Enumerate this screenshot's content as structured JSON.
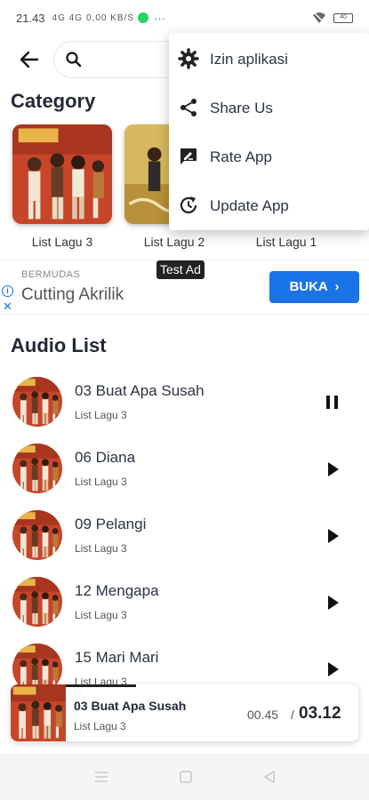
{
  "status_bar": {
    "time": "21.43",
    "signal": "4G 4G",
    "speed": "0,00 KB/S",
    "more": "···",
    "battery": "40"
  },
  "search": {
    "placeholder": ""
  },
  "category": {
    "heading": "Category",
    "items": [
      {
        "name": "List Lagu 3"
      },
      {
        "name": "List Lagu 2"
      },
      {
        "name": "List Lagu 1"
      }
    ]
  },
  "ad": {
    "tag": "Test Ad",
    "brand": "BERMUDAS",
    "headline": "Cutting Akrilik",
    "info": "i",
    "close": "✕",
    "cta": "BUKA"
  },
  "audio_list": {
    "heading": "Audio List",
    "items": [
      {
        "title": "03 Buat Apa Susah",
        "subtitle": "List Lagu 3",
        "state": "pause"
      },
      {
        "title": "06 Diana",
        "subtitle": "List Lagu 3",
        "state": "play"
      },
      {
        "title": "09 Pelangi",
        "subtitle": "List Lagu 3",
        "state": "play"
      },
      {
        "title": "12 Mengapa",
        "subtitle": "List Lagu 3",
        "state": "play"
      },
      {
        "title": "15 Mari Mari",
        "subtitle": "List Lagu 3",
        "state": "play"
      }
    ]
  },
  "player": {
    "title": "03 Buat Apa Susah",
    "subtitle": "List Lagu 3",
    "current_time": "00.45",
    "separator": "/",
    "total_time": "03.12",
    "progress": 0.24
  },
  "menu": {
    "items": [
      {
        "label": "Izin aplikasi",
        "icon": "gear-icon"
      },
      {
        "label": "Share Us",
        "icon": "share-icon"
      },
      {
        "label": "Rate App",
        "icon": "rate-icon"
      },
      {
        "label": "Update App",
        "icon": "update-icon"
      }
    ]
  },
  "colors": {
    "accent": "#1a73e8",
    "heading": "#222a36",
    "album_red": "#c8452a"
  }
}
